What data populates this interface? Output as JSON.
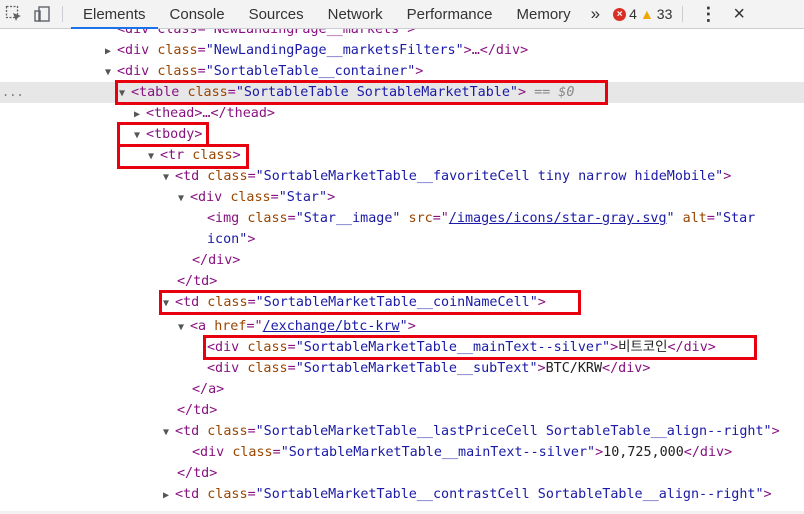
{
  "toolbar": {
    "tabs": [
      "Elements",
      "Console",
      "Sources",
      "Network",
      "Performance",
      "Memory"
    ],
    "overflow": "»",
    "errors": "4",
    "warnings": "33",
    "kebab": "⋮",
    "close": "×"
  },
  "tree": {
    "l0": {
      "text": "<div class=\"NewLandingPage__markets\">"
    },
    "l1": {
      "tag_open": "<div ",
      "attr": "class",
      "val": "\"NewLandingPage__marketsFilters\"",
      "rest": ">…</div>"
    },
    "l2": {
      "tag_open": "<div ",
      "attr": "class",
      "val": "\"SortableTable__container\"",
      "rest": ">"
    },
    "l3": {
      "dots": "...",
      "tag_open": "<table ",
      "attr": "class",
      "val": "\"SortableTable SortableMarketTable\"",
      "rest": ">",
      "eq": " == $0"
    },
    "l4": {
      "text": "<thead>…</thead>"
    },
    "l5": {
      "text": "<tbody>"
    },
    "l6": {
      "tag_open": "<tr ",
      "attr": "class",
      "rest": ">"
    },
    "l7": {
      "tag_open": "<td ",
      "attr": "class",
      "val": "\"SortableMarketTable__favoriteCell tiny narrow hideMobile\"",
      "rest": ">"
    },
    "l8": {
      "tag_open": "<div ",
      "attr": "class",
      "val": "\"Star\"",
      "rest": ">"
    },
    "l9": {
      "tag_open": "<img ",
      "attr": "class",
      "val": "\"Star__image\"",
      "attr2": " src",
      "val2": "/images/icons/star-gray.svg",
      "attr3": " alt",
      "val3": "\"Star"
    },
    "l10": {
      "val": "icon\"",
      "rest": ">"
    },
    "l11": {
      "text": "</div>"
    },
    "l12": {
      "text": "</td>"
    },
    "l13": {
      "tag_open": "<td ",
      "attr": "class",
      "val": "\"SortableMarketTable__coinNameCell\"",
      "rest": ">"
    },
    "l14": {
      "tag_open": "<a ",
      "attr": "href",
      "val": "/exchange/btc-krw",
      "rest": ">"
    },
    "l15": {
      "tag_open": "<div ",
      "attr": "class",
      "val": "\"SortableMarketTable__mainText--silver\"",
      "gt": ">",
      "content": "비트코인",
      "close": "</div>"
    },
    "l16": {
      "tag_open": "<div ",
      "attr": "class",
      "val": "\"SortableMarketTable__subText\"",
      "gt": ">",
      "content": "BTC/KRW",
      "close": "</div>"
    },
    "l17": {
      "text": "</a>"
    },
    "l18": {
      "text": "</td>"
    },
    "l19": {
      "tag_open": "<td ",
      "attr": "class",
      "val": "\"SortableMarketTable__lastPriceCell SortableTable__align--right\"",
      "rest": ">"
    },
    "l20": {
      "tag_open": "<div ",
      "attr": "class",
      "val": "\"SortableMarketTable__mainText--silver\"",
      "gt": ">",
      "content": "10,725,000",
      "close": "</div>"
    },
    "l21": {
      "text": "</td>"
    },
    "l22": {
      "tag_open": "<td ",
      "attr": "class",
      "val": "\"SortableMarketTable__contrastCell SortableTable__align--right\"",
      "rest": ">"
    }
  },
  "colors": {
    "tag": "#881280",
    "attr": "#994500",
    "value": "#1a1aa6",
    "highlight": "#e8000f",
    "selected_row": "#e7e7e7",
    "active_tab": "#1a73e8"
  }
}
